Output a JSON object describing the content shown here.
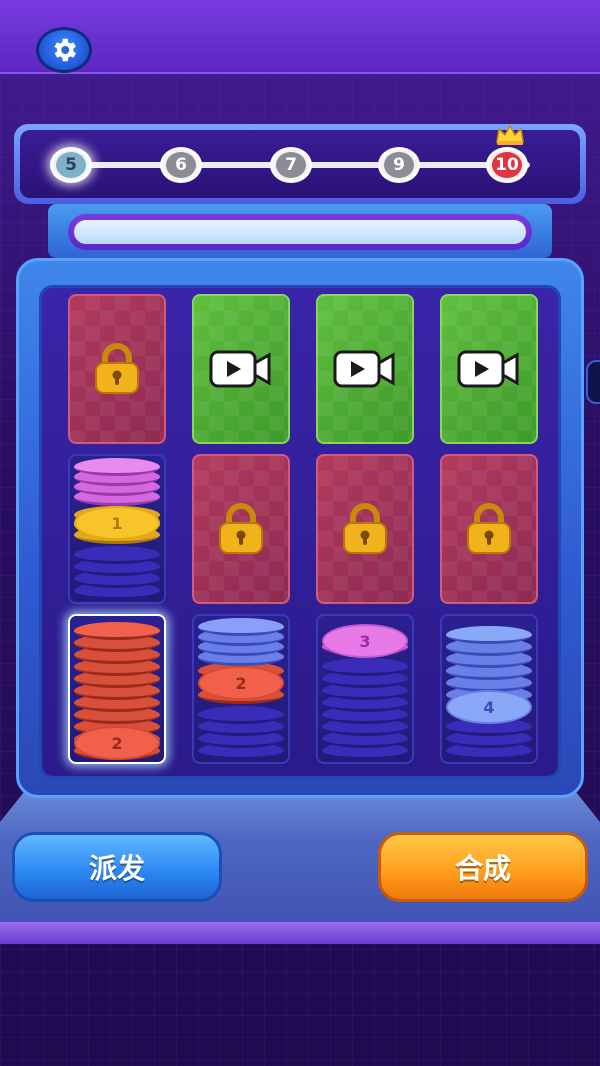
{
  "settings": {
    "icon": "gear-icon"
  },
  "progress": {
    "nodes": [
      {
        "label": "5",
        "state": "current"
      },
      {
        "label": "6",
        "state": "upcoming"
      },
      {
        "label": "7",
        "state": "upcoming"
      },
      {
        "label": "9",
        "state": "upcoming"
      },
      {
        "label": "10",
        "state": "final"
      }
    ],
    "crown_icon": "crown-icon"
  },
  "grid": {
    "row1": [
      {
        "type": "locked",
        "icon": "lock-icon"
      },
      {
        "type": "video",
        "icon": "video-camera-icon"
      },
      {
        "type": "video",
        "icon": "video-camera-icon"
      },
      {
        "type": "video",
        "icon": "video-camera-icon"
      }
    ],
    "row2": [
      {
        "type": "tube",
        "top_label": "1",
        "top_color": "#f5c52a"
      },
      {
        "type": "locked",
        "icon": "lock-icon"
      },
      {
        "type": "locked",
        "icon": "lock-icon"
      },
      {
        "type": "locked",
        "icon": "lock-icon"
      }
    ],
    "row3": [
      {
        "type": "tube",
        "top_label": "2",
        "top_color": "#f0604a",
        "selected": true
      },
      {
        "type": "tube",
        "top_label": "2",
        "top_color": "#f0604a"
      },
      {
        "type": "tube",
        "top_label": "3",
        "top_color": "#e87ae8"
      },
      {
        "type": "tube",
        "top_label": "4",
        "top_color": "#8aa8f8"
      }
    ]
  },
  "buttons": {
    "deal_label": "派发",
    "merge_label": "合成"
  },
  "colors": {
    "deal_button": "#2a86f0",
    "merge_button": "#ff9c1a",
    "locked_slot": "#b23a5e",
    "video_slot": "#5fbf3e"
  }
}
